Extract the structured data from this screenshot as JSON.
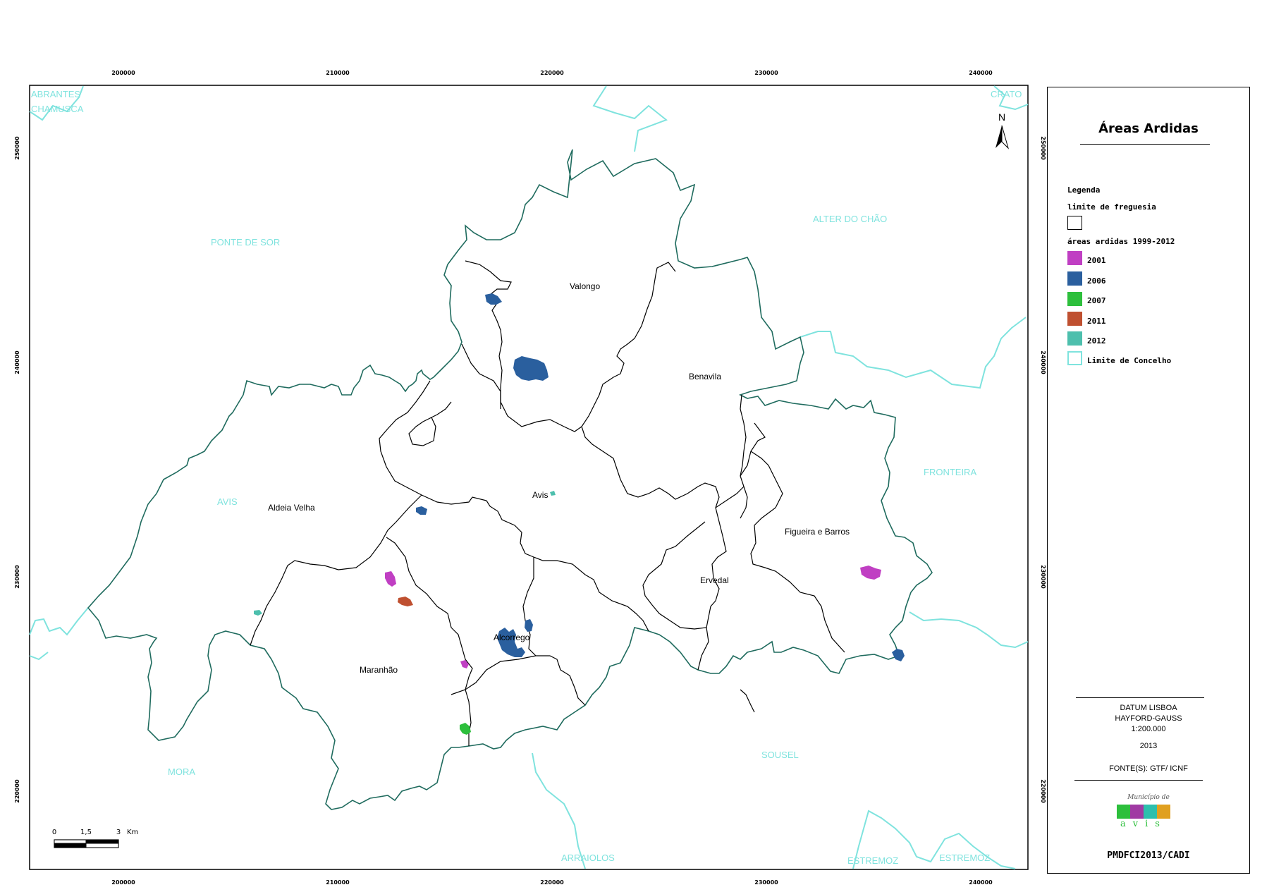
{
  "map": {
    "top_ticks": [
      "200000",
      "210000",
      "220000",
      "230000",
      "240000"
    ],
    "bottom_ticks": [
      "200000",
      "210000",
      "220000",
      "230000",
      "240000"
    ],
    "left_ticks": [
      "250000",
      "240000",
      "230000",
      "220000"
    ],
    "right_ticks": [
      "250000",
      "240000",
      "230000",
      "220000"
    ],
    "neighbors": {
      "abrantes": "ABRANTES",
      "chamusca": "CHAMUSCA",
      "crato": "CRATO",
      "ponte_de_sor": "PONTE DE SOR",
      "alter_do_chao": "ALTER DO CHÃO",
      "avis": "AVIS",
      "fronteira": "FRONTEIRA",
      "mora": "MORA",
      "sousel": "SOUSEL",
      "arraiolos": "ARRAIOLOS",
      "estremoz_1": "ESTREMOZ",
      "estremoz_2": "ESTREMOZ"
    },
    "parishes": {
      "valongo": "Valongo",
      "benavila": "Benavila",
      "aldeia_velha": "Aldeia Velha",
      "avis": "Avis",
      "figueira_e_barros": "Figueira e Barros",
      "ervedal": "Ervedal",
      "alcorrego": "Alcorrego",
      "maranhao": "Maranhão"
    },
    "north_label": "N",
    "scale_bar": {
      "labels": [
        "0",
        "1,5",
        "3"
      ],
      "unit": "Km"
    }
  },
  "legend": {
    "title": "Áreas Ardidas",
    "heading": "Legenda",
    "freguesia_label": "limite de freguesia",
    "burned_heading": "áreas ardidas 1999-2012",
    "years": [
      {
        "label": "2001",
        "color": "#c03fc3"
      },
      {
        "label": "2006",
        "color": "#2a5f9e"
      },
      {
        "label": "2007",
        "color": "#2dbf3c"
      },
      {
        "label": "2011",
        "color": "#bf5030"
      },
      {
        "label": "2012",
        "color": "#4dbfad"
      }
    ],
    "concelho_label": "Limite de Concelho",
    "concelho_color": "#7fe3de",
    "datum": "DATUM LISBOA",
    "projection": "HAYFORD-GAUSS",
    "scale": "1:200.000",
    "year": "2013",
    "source": "FONTE(S): GTF/ ICNF",
    "municipality_caption": "Município de",
    "logo_letters": "avis",
    "code": "PMDFCI2013/CADI"
  }
}
